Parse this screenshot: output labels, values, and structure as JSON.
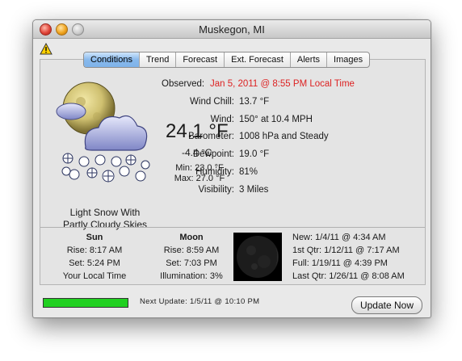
{
  "window": {
    "title": "Muskegon, MI"
  },
  "tabs": [
    {
      "label": "Conditions",
      "active": true
    },
    {
      "label": "Trend"
    },
    {
      "label": "Forecast"
    },
    {
      "label": "Ext. Forecast"
    },
    {
      "label": "Alerts"
    },
    {
      "label": "Images"
    }
  ],
  "observed": {
    "label": "Observed:",
    "value": "Jan 5, 2011 @ 8:55 PM Local Time",
    "color": "#dd2222"
  },
  "conditions": {
    "icon": "partly-cloudy-night-snow-icon",
    "description_line1": "Light Snow With",
    "description_line2": "Partly Cloudy Skies",
    "temp_f": "24.1 °F",
    "temp_c": "-4.4 °C",
    "min": "Min: 23.0 °F",
    "max": "Max: 27.0 °F"
  },
  "details": [
    {
      "label": "Wind Chill:",
      "value": "13.7 °F"
    },
    {
      "label": "Wind:",
      "value": "150° at 10.4 MPH"
    },
    {
      "label": "Barometer:",
      "value": "1008 hPa and Steady"
    },
    {
      "label": "Dewpoint:",
      "value": "19.0 °F"
    },
    {
      "label": "Humidity:",
      "value": "81%"
    },
    {
      "label": "Visibility:",
      "value": "3 Miles"
    }
  ],
  "sun": {
    "title": "Sun",
    "rise": "Rise: 8:17 AM",
    "set": "Set: 5:24 PM",
    "note": "Your Local Time"
  },
  "moon": {
    "title": "Moon",
    "rise": "Rise: 8:59 AM",
    "set": "Set: 7:03 PM",
    "illumination": "Illumination: 3%"
  },
  "phases": [
    "New: 1/4/11 @ 4:34 AM",
    "1st Qtr: 1/12/11 @ 7:17 AM",
    "Full: 1/19/11 @ 4:39 PM",
    "Last Qtr: 1/26/11 @ 8:08 AM"
  ],
  "footer": {
    "progress": 1.0,
    "progress_color": "#20d020",
    "next_update": "Next Update: 1/5/11 @ 10:10 PM",
    "update_button": "Update Now"
  }
}
